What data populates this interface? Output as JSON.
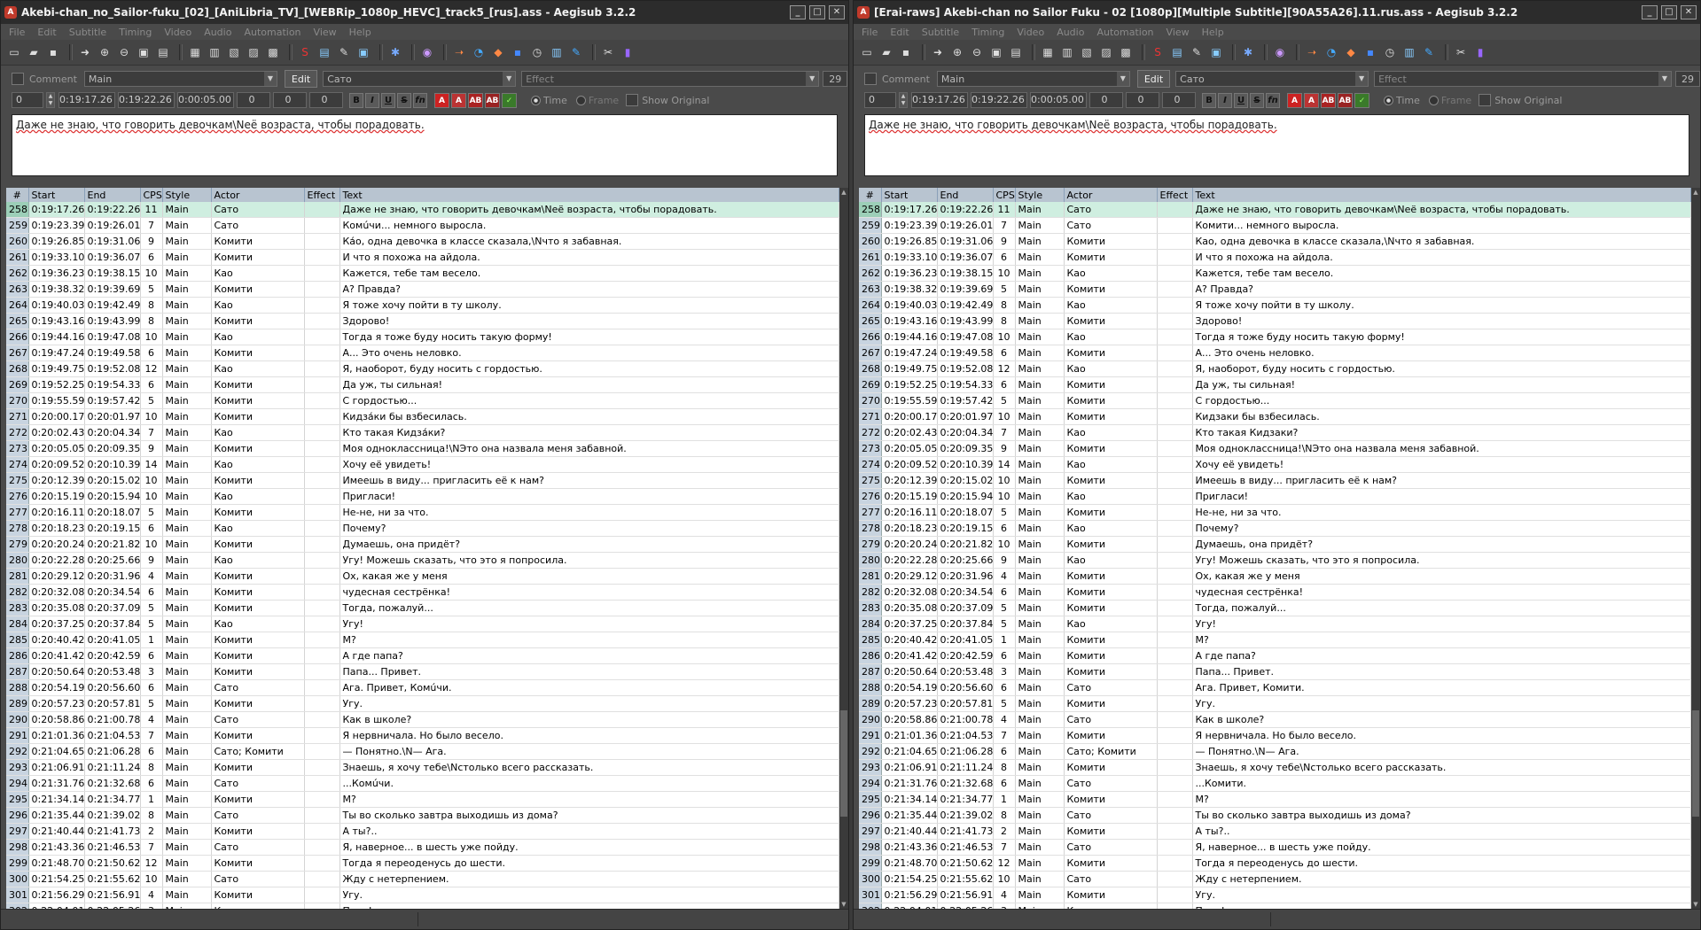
{
  "windows": [
    {
      "title": "Akebi-chan_no_Sailor-fuku_[02]_[AniLibria_TV]_[WEBRip_1080p_HEVC]_track5_[rus].ass - Aegisub 3.2.2",
      "edit_text": "Даже не знаю, что говорить девочкам\\Nеё возраста, чтобы порадовать.",
      "rows": [
        [
          "258",
          "0:19:17.26",
          "0:19:22.26",
          "11",
          "Main",
          "Сато",
          "",
          "Даже не знаю, что говорить девочкам\\Nеё возраста, чтобы порадовать."
        ],
        [
          "259",
          "0:19:23.39",
          "0:19:26.01",
          "7",
          "Main",
          "Сато",
          "",
          "Комúчи... немного выросла."
        ],
        [
          "260",
          "0:19:26.85",
          "0:19:31.06",
          "9",
          "Main",
          "Комити",
          "",
          "Ка́о, одна девочка в классе сказала,\\Nчто я забавная."
        ],
        [
          "261",
          "0:19:33.10",
          "0:19:36.07",
          "6",
          "Main",
          "Комити",
          "",
          "И что я похожа на айдола."
        ],
        [
          "262",
          "0:19:36.23",
          "0:19:38.15",
          "10",
          "Main",
          "Као",
          "",
          "Кажется, тебе там весело."
        ],
        [
          "263",
          "0:19:38.32",
          "0:19:39.69",
          "5",
          "Main",
          "Комити",
          "",
          "А? Правда?"
        ],
        [
          "264",
          "0:19:40.03",
          "0:19:42.49",
          "8",
          "Main",
          "Као",
          "",
          "Я тоже хочу пойти в ту школу."
        ],
        [
          "265",
          "0:19:43.16",
          "0:19:43.99",
          "8",
          "Main",
          "Комити",
          "",
          "Здорово!"
        ],
        [
          "266",
          "0:19:44.16",
          "0:19:47.08",
          "10",
          "Main",
          "Као",
          "",
          "Тогда я тоже буду носить такую форму!"
        ],
        [
          "267",
          "0:19:47.24",
          "0:19:49.58",
          "6",
          "Main",
          "Комити",
          "",
          "А... Это очень неловко."
        ],
        [
          "268",
          "0:19:49.75",
          "0:19:52.08",
          "12",
          "Main",
          "Као",
          "",
          "Я, наоборот, буду носить с гордостью."
        ],
        [
          "269",
          "0:19:52.25",
          "0:19:54.33",
          "6",
          "Main",
          "Комити",
          "",
          "Да уж, ты сильная!"
        ],
        [
          "270",
          "0:19:55.59",
          "0:19:57.42",
          "5",
          "Main",
          "Комити",
          "",
          "С гордостью..."
        ],
        [
          "271",
          "0:20:00.17",
          "0:20:01.97",
          "10",
          "Main",
          "Комити",
          "",
          "Кидза́ки бы взбесилась."
        ],
        [
          "272",
          "0:20:02.43",
          "0:20:04.34",
          "7",
          "Main",
          "Као",
          "",
          "Кто такая Кидза́ки?"
        ],
        [
          "273",
          "0:20:05.05",
          "0:20:09.35",
          "9",
          "Main",
          "Комити",
          "",
          "Моя одноклассница!\\NЭто она назвала меня забавной."
        ],
        [
          "274",
          "0:20:09.52",
          "0:20:10.39",
          "14",
          "Main",
          "Као",
          "",
          "Хочу её увидеть!"
        ],
        [
          "275",
          "0:20:12.39",
          "0:20:15.02",
          "10",
          "Main",
          "Комити",
          "",
          "Имеешь в виду... пригласить её к нам?"
        ],
        [
          "276",
          "0:20:15.19",
          "0:20:15.94",
          "10",
          "Main",
          "Као",
          "",
          "Пригласи!"
        ],
        [
          "277",
          "0:20:16.11",
          "0:20:18.07",
          "5",
          "Main",
          "Комити",
          "",
          "Не-не, ни за что."
        ],
        [
          "278",
          "0:20:18.23",
          "0:20:19.15",
          "6",
          "Main",
          "Као",
          "",
          "Почему?"
        ],
        [
          "279",
          "0:20:20.24",
          "0:20:21.82",
          "10",
          "Main",
          "Комити",
          "",
          "Думаешь, она придёт?"
        ],
        [
          "280",
          "0:20:22.28",
          "0:20:25.66",
          "9",
          "Main",
          "Као",
          "",
          "Угу! Можешь сказать, что это я попросила."
        ],
        [
          "281",
          "0:20:29.12",
          "0:20:31.96",
          "4",
          "Main",
          "Комити",
          "",
          "Ох, какая же у меня"
        ],
        [
          "282",
          "0:20:32.08",
          "0:20:34.54",
          "6",
          "Main",
          "Комити",
          "",
          "чудесная сестрёнка!"
        ],
        [
          "283",
          "0:20:35.08",
          "0:20:37.09",
          "5",
          "Main",
          "Комити",
          "",
          "Тогда, пожалуй..."
        ],
        [
          "284",
          "0:20:37.25",
          "0:20:37.84",
          "5",
          "Main",
          "Као",
          "",
          "Угу!"
        ],
        [
          "285",
          "0:20:40.42",
          "0:20:41.05",
          "1",
          "Main",
          "Комити",
          "",
          "М?"
        ],
        [
          "286",
          "0:20:41.42",
          "0:20:42.59",
          "6",
          "Main",
          "Комити",
          "",
          "А где папа?"
        ],
        [
          "287",
          "0:20:50.64",
          "0:20:53.48",
          "3",
          "Main",
          "Комити",
          "",
          "Папа... Привет."
        ],
        [
          "288",
          "0:20:54.19",
          "0:20:56.60",
          "6",
          "Main",
          "Сато",
          "",
          "Ага. Привет, Комúчи."
        ],
        [
          "289",
          "0:20:57.23",
          "0:20:57.81",
          "5",
          "Main",
          "Комити",
          "",
          "Угу."
        ],
        [
          "290",
          "0:20:58.86",
          "0:21:00.78",
          "4",
          "Main",
          "Сато",
          "",
          "Как в школе?"
        ],
        [
          "291",
          "0:21:01.36",
          "0:21:04.53",
          "7",
          "Main",
          "Комити",
          "",
          "Я нервничала. Но было весело."
        ],
        [
          "292",
          "0:21:04.65",
          "0:21:06.28",
          "6",
          "Main",
          "Сато; Комити",
          "",
          "— Понятно.\\N— Ага."
        ],
        [
          "293",
          "0:21:06.91",
          "0:21:11.24",
          "8",
          "Main",
          "Комити",
          "",
          "Знаешь, я хочу тебе\\Nстолько всего рассказать."
        ],
        [
          "294",
          "0:21:31.76",
          "0:21:32.68",
          "6",
          "Main",
          "Сато",
          "",
          "...Комúчи."
        ],
        [
          "295",
          "0:21:34.14",
          "0:21:34.77",
          "1",
          "Main",
          "Комити",
          "",
          "М?"
        ],
        [
          "296",
          "0:21:35.44",
          "0:21:39.02",
          "8",
          "Main",
          "Сато",
          "",
          "Ты во сколько завтра выходишь из дома?"
        ],
        [
          "297",
          "0:21:40.44",
          "0:21:41.73",
          "2",
          "Main",
          "Комити",
          "",
          "А ты?.."
        ],
        [
          "298",
          "0:21:43.36",
          "0:21:46.53",
          "7",
          "Main",
          "Сато",
          "",
          "Я, наверное... в шесть уже пойду."
        ],
        [
          "299",
          "0:21:48.70",
          "0:21:50.62",
          "12",
          "Main",
          "Комити",
          "",
          "Тогда я переоденусь до шести."
        ],
        [
          "300",
          "0:21:54.25",
          "0:21:55.62",
          "10",
          "Main",
          "Сато",
          "",
          "Жду с нетерпением."
        ],
        [
          "301",
          "0:21:56.29",
          "0:21:56.91",
          "4",
          "Main",
          "Комити",
          "",
          "Угу."
        ],
        [
          "302",
          "0:22:04.01",
          "0:22:05.26",
          "3",
          "Main",
          "Комити",
          "",
          "Папа!"
        ],
        [
          "303",
          "0:22:05.51",
          "0:22:06.17",
          "4",
          "Main",
          "Сато",
          "",
          "Что?"
        ],
        [
          "304",
          "0:22:07.26",
          "0:22:08.68",
          "5",
          "Main",
          "Комити",
          "",
          "До завтра!"
        ]
      ]
    },
    {
      "title": "[Erai-raws] Akebi-chan no Sailor Fuku - 02 [1080p][Multiple Subtitle][90A55A26].11.rus.ass - Aegisub 3.2.2",
      "edit_text": "Даже не знаю, что говорить девочкам\\Nеё возраста, чтобы порадовать.",
      "rows": [
        [
          "258",
          "0:19:17.26",
          "0:19:22.26",
          "11",
          "Main",
          "Сато",
          "",
          "Даже не знаю, что говорить девочкам\\Nеё возраста, чтобы порадовать."
        ],
        [
          "259",
          "0:19:23.39",
          "0:19:26.01",
          "7",
          "Main",
          "Сато",
          "",
          "Комити... немного выросла."
        ],
        [
          "260",
          "0:19:26.85",
          "0:19:31.06",
          "9",
          "Main",
          "Комити",
          "",
          "Као, одна девочка в классе сказала,\\Nчто я забавная."
        ],
        [
          "261",
          "0:19:33.10",
          "0:19:36.07",
          "6",
          "Main",
          "Комити",
          "",
          "И что я похожа на айдола."
        ],
        [
          "262",
          "0:19:36.23",
          "0:19:38.15",
          "10",
          "Main",
          "Као",
          "",
          "Кажется, тебе там весело."
        ],
        [
          "263",
          "0:19:38.32",
          "0:19:39.69",
          "5",
          "Main",
          "Комити",
          "",
          "А? Правда?"
        ],
        [
          "264",
          "0:19:40.03",
          "0:19:42.49",
          "8",
          "Main",
          "Као",
          "",
          "Я тоже хочу пойти в ту школу."
        ],
        [
          "265",
          "0:19:43.16",
          "0:19:43.99",
          "8",
          "Main",
          "Комити",
          "",
          "Здорово!"
        ],
        [
          "266",
          "0:19:44.16",
          "0:19:47.08",
          "10",
          "Main",
          "Као",
          "",
          "Тогда я тоже буду носить такую форму!"
        ],
        [
          "267",
          "0:19:47.24",
          "0:19:49.58",
          "6",
          "Main",
          "Комити",
          "",
          "А... Это очень неловко."
        ],
        [
          "268",
          "0:19:49.75",
          "0:19:52.08",
          "12",
          "Main",
          "Као",
          "",
          "Я, наоборот, буду носить с гордостью."
        ],
        [
          "269",
          "0:19:52.25",
          "0:19:54.33",
          "6",
          "Main",
          "Комити",
          "",
          "Да уж, ты сильная!"
        ],
        [
          "270",
          "0:19:55.59",
          "0:19:57.42",
          "5",
          "Main",
          "Комити",
          "",
          "С гордостью..."
        ],
        [
          "271",
          "0:20:00.17",
          "0:20:01.97",
          "10",
          "Main",
          "Комити",
          "",
          "Кидзаки бы взбесилась."
        ],
        [
          "272",
          "0:20:02.43",
          "0:20:04.34",
          "7",
          "Main",
          "Као",
          "",
          "Кто такая Кидзаки?"
        ],
        [
          "273",
          "0:20:05.05",
          "0:20:09.35",
          "9",
          "Main",
          "Комити",
          "",
          "Моя одноклассница!\\NЭто она назвала меня забавной."
        ],
        [
          "274",
          "0:20:09.52",
          "0:20:10.39",
          "14",
          "Main",
          "Као",
          "",
          "Хочу её увидеть!"
        ],
        [
          "275",
          "0:20:12.39",
          "0:20:15.02",
          "10",
          "Main",
          "Комити",
          "",
          "Имеешь в виду... пригласить её к нам?"
        ],
        [
          "276",
          "0:20:15.19",
          "0:20:15.94",
          "10",
          "Main",
          "Као",
          "",
          "Пригласи!"
        ],
        [
          "277",
          "0:20:16.11",
          "0:20:18.07",
          "5",
          "Main",
          "Комити",
          "",
          "Не-не, ни за что."
        ],
        [
          "278",
          "0:20:18.23",
          "0:20:19.15",
          "6",
          "Main",
          "Као",
          "",
          "Почему?"
        ],
        [
          "279",
          "0:20:20.24",
          "0:20:21.82",
          "10",
          "Main",
          "Комити",
          "",
          "Думаешь, она придёт?"
        ],
        [
          "280",
          "0:20:22.28",
          "0:20:25.66",
          "9",
          "Main",
          "Као",
          "",
          "Угу! Можешь сказать, что это я попросила."
        ],
        [
          "281",
          "0:20:29.12",
          "0:20:31.96",
          "4",
          "Main",
          "Комити",
          "",
          "Ох, какая же у меня"
        ],
        [
          "282",
          "0:20:32.08",
          "0:20:34.54",
          "6",
          "Main",
          "Комити",
          "",
          "чудесная сестрёнка!"
        ],
        [
          "283",
          "0:20:35.08",
          "0:20:37.09",
          "5",
          "Main",
          "Комити",
          "",
          "Тогда, пожалуй..."
        ],
        [
          "284",
          "0:20:37.25",
          "0:20:37.84",
          "5",
          "Main",
          "Као",
          "",
          "Угу!"
        ],
        [
          "285",
          "0:20:40.42",
          "0:20:41.05",
          "1",
          "Main",
          "Комити",
          "",
          "М?"
        ],
        [
          "286",
          "0:20:41.42",
          "0:20:42.59",
          "6",
          "Main",
          "Комити",
          "",
          "А где папа?"
        ],
        [
          "287",
          "0:20:50.64",
          "0:20:53.48",
          "3",
          "Main",
          "Комити",
          "",
          "Папа... Привет."
        ],
        [
          "288",
          "0:20:54.19",
          "0:20:56.60",
          "6",
          "Main",
          "Сато",
          "",
          "Ага. Привет, Комити."
        ],
        [
          "289",
          "0:20:57.23",
          "0:20:57.81",
          "5",
          "Main",
          "Комити",
          "",
          "Угу."
        ],
        [
          "290",
          "0:20:58.86",
          "0:21:00.78",
          "4",
          "Main",
          "Сато",
          "",
          "Как в школе?"
        ],
        [
          "291",
          "0:21:01.36",
          "0:21:04.53",
          "7",
          "Main",
          "Комити",
          "",
          "Я нервничала. Но было весело."
        ],
        [
          "292",
          "0:21:04.65",
          "0:21:06.28",
          "6",
          "Main",
          "Сато; Комити",
          "",
          "— Понятно.\\N— Ага."
        ],
        [
          "293",
          "0:21:06.91",
          "0:21:11.24",
          "8",
          "Main",
          "Комити",
          "",
          "Знаешь, я хочу тебе\\Nстолько всего рассказать."
        ],
        [
          "294",
          "0:21:31.76",
          "0:21:32.68",
          "6",
          "Main",
          "Сато",
          "",
          "...Комити."
        ],
        [
          "295",
          "0:21:34.14",
          "0:21:34.77",
          "1",
          "Main",
          "Комити",
          "",
          "М?"
        ],
        [
          "296",
          "0:21:35.44",
          "0:21:39.02",
          "8",
          "Main",
          "Сато",
          "",
          "Ты во сколько завтра выходишь из дома?"
        ],
        [
          "297",
          "0:21:40.44",
          "0:21:41.73",
          "2",
          "Main",
          "Комити",
          "",
          "А ты?.."
        ],
        [
          "298",
          "0:21:43.36",
          "0:21:46.53",
          "7",
          "Main",
          "Сато",
          "",
          "Я, наверное... в шесть уже пойду."
        ],
        [
          "299",
          "0:21:48.70",
          "0:21:50.62",
          "12",
          "Main",
          "Комити",
          "",
          "Тогда я переоденусь до шести."
        ],
        [
          "300",
          "0:21:54.25",
          "0:21:55.62",
          "10",
          "Main",
          "Сато",
          "",
          "Жду с нетерпением."
        ],
        [
          "301",
          "0:21:56.29",
          "0:21:56.91",
          "4",
          "Main",
          "Комити",
          "",
          "Угу."
        ],
        [
          "302",
          "0:22:04.01",
          "0:22:05.26",
          "3",
          "Main",
          "Комити",
          "",
          "Папа!"
        ],
        [
          "303",
          "0:22:05.51",
          "0:22:06.17",
          "4",
          "Main",
          "Сато",
          "",
          "Что?"
        ],
        [
          "304",
          "0:22:07.26",
          "0:22:08.68",
          "5",
          "Main",
          "Комити",
          "",
          "До завтра!"
        ]
      ]
    }
  ],
  "menu": [
    "File",
    "Edit",
    "Subtitle",
    "Timing",
    "Video",
    "Audio",
    "Automation",
    "View",
    "Help"
  ],
  "controls": {
    "comment_label": "Comment",
    "style": "Main",
    "edit_button": "Edit",
    "actor": "Сато",
    "effect_placeholder": "Effect",
    "char_count": "29",
    "layer": "0",
    "start": "0:19:17.26",
    "end": "0:19:22.26",
    "duration": "0:00:05.00",
    "margin_l": "0",
    "margin_r": "0",
    "margin_v": "0",
    "time_label": "Time",
    "frame_label": "Frame",
    "show_original_label": "Show Original"
  },
  "columns": [
    "#",
    "Start",
    "End",
    "CPS",
    "Style",
    "Actor",
    "Effect",
    "Text"
  ],
  "selected_row": "258",
  "colors": {
    "selected_row": "#cfeee0",
    "header": "#b8c4d0",
    "window_bg": "#4a4a4a"
  }
}
